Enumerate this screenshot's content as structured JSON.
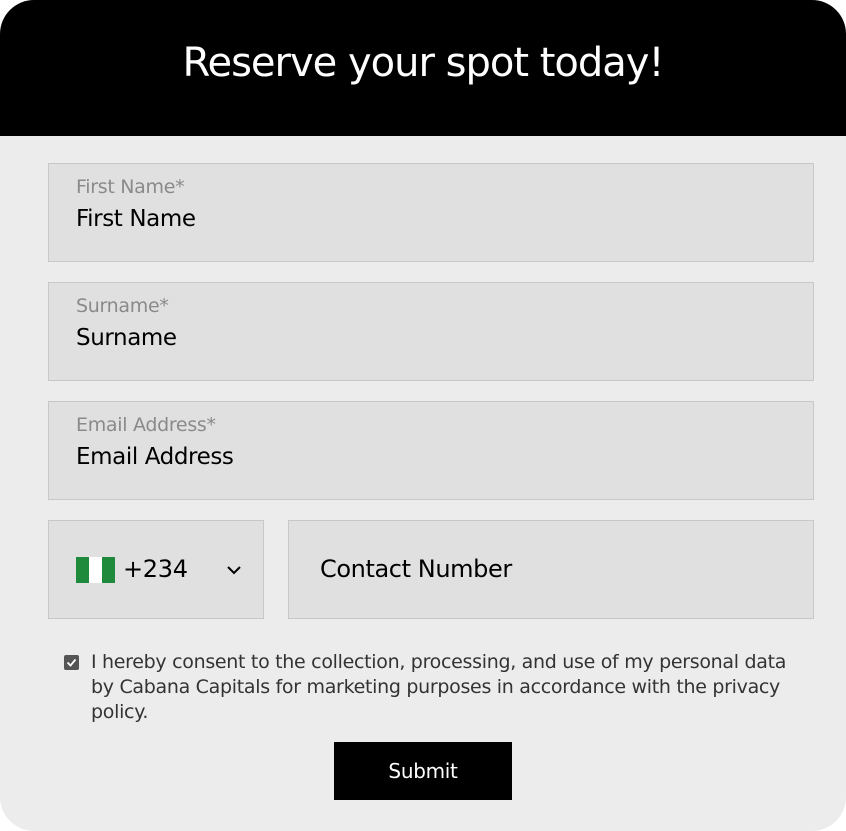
{
  "header": {
    "title": "Reserve your spot today!"
  },
  "form": {
    "first_name": {
      "label": "First Name*",
      "placeholder": "First Name"
    },
    "surname": {
      "label": "Surname*",
      "placeholder": "Surname"
    },
    "email": {
      "label": "Email Address*",
      "placeholder": "Email Address"
    },
    "country_code": {
      "flag": "nigeria-flag-icon",
      "value": "+234",
      "dropdown_icon": "chevron-down-icon"
    },
    "phone": {
      "placeholder": "Contact Number"
    },
    "consent": {
      "checked": true,
      "text": "I hereby consent to the collection, processing, and use of my personal data by Cabana Capitals for marketing purposes in accordance with the privacy policy."
    },
    "submit_label": "Submit"
  },
  "colors": {
    "header_bg": "#000000",
    "card_bg": "#ececec",
    "field_bg": "#e0e0e0",
    "flag_green": "#1f8a3b",
    "button_bg": "#000000"
  }
}
